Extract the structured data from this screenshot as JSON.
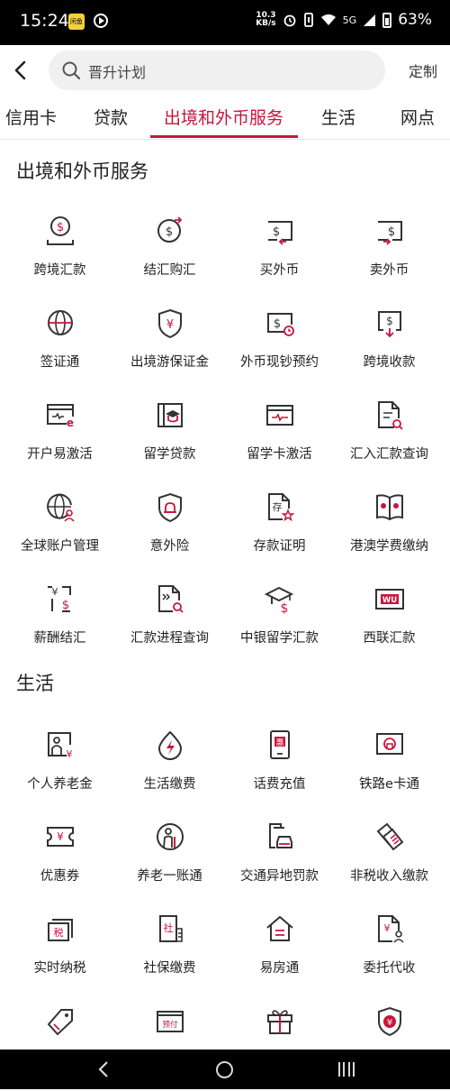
{
  "status_bar": {
    "time": "15:24",
    "app_icon_text": "闲鱼",
    "net_speed_value": "10.3",
    "net_speed_unit": "KB/s",
    "network": "5G",
    "battery": "63%"
  },
  "header": {
    "search_placeholder": "晋升计划",
    "customize_label": "定制"
  },
  "tabs": [
    {
      "label": "信用卡",
      "active": false
    },
    {
      "label": "贷款",
      "active": false
    },
    {
      "label": "出境和外币服务",
      "active": true
    },
    {
      "label": "生活",
      "active": false
    },
    {
      "label": "网点",
      "active": false
    }
  ],
  "sections": [
    {
      "title": "出境和外币服务",
      "items": [
        {
          "label": "跨境汇款",
          "icon": "coin-tray-icon"
        },
        {
          "label": "结汇购汇",
          "icon": "currency-exchange-icon"
        },
        {
          "label": "买外币",
          "icon": "buy-foreign-currency-icon"
        },
        {
          "label": "卖外币",
          "icon": "sell-foreign-currency-icon"
        },
        {
          "label": "签证通",
          "icon": "globe-icon"
        },
        {
          "label": "出境游保证金",
          "icon": "yuan-shield-icon"
        },
        {
          "label": "外币现钞预约",
          "icon": "cash-clock-icon"
        },
        {
          "label": "跨境收款",
          "icon": "receive-payment-icon"
        },
        {
          "label": "开户易激活",
          "icon": "card-activate-icon"
        },
        {
          "label": "留学贷款",
          "icon": "graduation-book-icon"
        },
        {
          "label": "留学卡激活",
          "icon": "card-pulse-icon"
        },
        {
          "label": "汇入汇款查询",
          "icon": "document-search-icon"
        },
        {
          "label": "全球账户管理",
          "icon": "globe-user-icon"
        },
        {
          "label": "意外险",
          "icon": "alarm-shield-icon"
        },
        {
          "label": "存款证明",
          "icon": "deposit-certificate-icon"
        },
        {
          "label": "港澳学费缴纳",
          "icon": "hk-macau-book-icon"
        },
        {
          "label": "薪酬结汇",
          "icon": "salary-exchange-icon"
        },
        {
          "label": "汇款进程查询",
          "icon": "remittance-progress-icon"
        },
        {
          "label": "中银留学汇款",
          "icon": "graduation-cap-dollar-icon"
        },
        {
          "label": "西联汇款",
          "icon": "western-union-icon"
        }
      ]
    },
    {
      "title": "生活",
      "items": [
        {
          "label": "个人养老金",
          "icon": "pension-icon"
        },
        {
          "label": "生活缴费",
          "icon": "utility-bolt-icon"
        },
        {
          "label": "话费充值",
          "icon": "phone-topup-icon"
        },
        {
          "label": "铁路e卡通",
          "icon": "railway-card-icon"
        },
        {
          "label": "优惠券",
          "icon": "coupon-icon"
        },
        {
          "label": "养老一账通",
          "icon": "elderly-account-icon"
        },
        {
          "label": "交通异地罚款",
          "icon": "traffic-fine-icon"
        },
        {
          "label": "非税收入缴款",
          "icon": "non-tax-payment-icon"
        },
        {
          "label": "实时纳税",
          "icon": "tax-icon"
        },
        {
          "label": "社保缴费",
          "icon": "social-security-icon"
        },
        {
          "label": "易房通",
          "icon": "house-icon"
        },
        {
          "label": "委托代收",
          "icon": "entrusted-collection-icon"
        },
        {
          "label": "",
          "icon": "tag-icon"
        },
        {
          "label": "",
          "icon": "prepaid-icon"
        },
        {
          "label": "",
          "icon": "gift-icon"
        },
        {
          "label": "",
          "icon": "yuan-shield-icon"
        }
      ]
    }
  ],
  "icon_text": {
    "deposit": "存",
    "salary_yuan": "¥",
    "wu": "WU",
    "hui": "惠",
    "shui": "税",
    "she": "社",
    "prepaid": "预付"
  },
  "colors": {
    "accent": "#c8153c",
    "icon_stroke": "#333333"
  }
}
